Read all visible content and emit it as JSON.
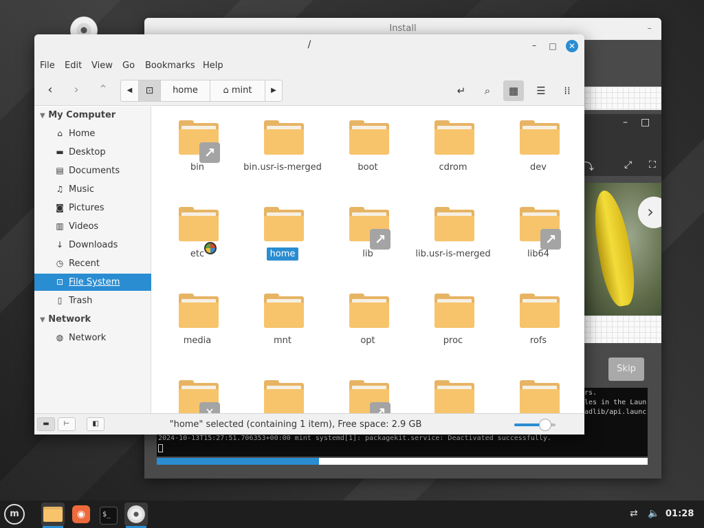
{
  "background_window": {
    "title": "Install",
    "skip_label": "Skip",
    "log_lines": [
      "rs.",
      "les in the Laun",
      "adlib/api.launc",
      "2024-10-13T15:27:51.706353+00:00 mint systemd[1]: packagekit.service: Deactivated successfully."
    ],
    "progress": 0.33
  },
  "window": {
    "title": "/",
    "minimize": "–",
    "maximize": "□",
    "close": "✕"
  },
  "menu": {
    "file": "File",
    "edit": "Edit",
    "view": "View",
    "go": "Go",
    "bookmarks": "Bookmarks",
    "help": "Help"
  },
  "breadcrumb": {
    "items": [
      "home",
      "mint"
    ]
  },
  "sidebar": {
    "my_computer": "My Computer",
    "places": [
      {
        "label": "Home",
        "icon": "home-icon"
      },
      {
        "label": "Desktop",
        "icon": "desktop-icon"
      },
      {
        "label": "Documents",
        "icon": "documents-icon"
      },
      {
        "label": "Music",
        "icon": "music-icon"
      },
      {
        "label": "Pictures",
        "icon": "pictures-icon"
      },
      {
        "label": "Videos",
        "icon": "videos-icon"
      },
      {
        "label": "Downloads",
        "icon": "downloads-icon"
      },
      {
        "label": "Recent",
        "icon": "recent-icon"
      },
      {
        "label": "File System",
        "icon": "filesystem-icon"
      },
      {
        "label": "Trash",
        "icon": "trash-icon"
      }
    ],
    "network_header": "Network",
    "network_items": [
      {
        "label": "Network",
        "icon": "network-icon"
      }
    ]
  },
  "folders": [
    {
      "name": "bin",
      "emblem": "link"
    },
    {
      "name": "bin.usr-is-merged",
      "emblem": ""
    },
    {
      "name": "boot",
      "emblem": ""
    },
    {
      "name": "cdrom",
      "emblem": ""
    },
    {
      "name": "dev",
      "emblem": ""
    },
    {
      "name": "etc",
      "emblem": "lock"
    },
    {
      "name": "home",
      "emblem": "",
      "selected": true
    },
    {
      "name": "lib",
      "emblem": "link"
    },
    {
      "name": "lib.usr-is-merged",
      "emblem": ""
    },
    {
      "name": "lib64",
      "emblem": "link"
    },
    {
      "name": "media",
      "emblem": ""
    },
    {
      "name": "mnt",
      "emblem": ""
    },
    {
      "name": "opt",
      "emblem": ""
    },
    {
      "name": "proc",
      "emblem": ""
    },
    {
      "name": "rofs",
      "emblem": ""
    },
    {
      "name": "",
      "emblem": "x"
    },
    {
      "name": "",
      "emblem": ""
    },
    {
      "name": "",
      "emblem": "link"
    },
    {
      "name": "",
      "emblem": ""
    },
    {
      "name": "",
      "emblem": ""
    }
  ],
  "status": {
    "text": "\"home\" selected (containing 1 item), Free space: 2.9 GB",
    "zoom": 0.75
  },
  "taskbar": {
    "clock": "01:28"
  },
  "colors": {
    "accent": "#2a8dd2",
    "folder": "#f7c46c"
  }
}
